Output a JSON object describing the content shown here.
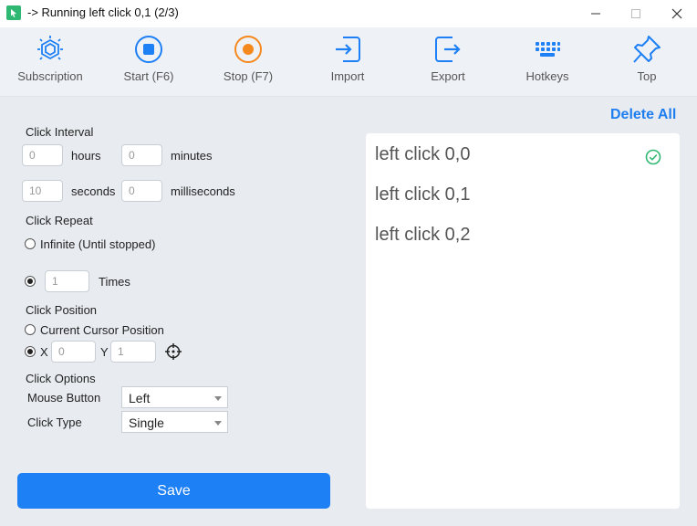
{
  "window": {
    "title": "-> Running left click 0,1 (2/3)"
  },
  "toolbar": {
    "items": [
      {
        "label": "Subscription",
        "icon": "gem-icon"
      },
      {
        "label": "Start (F6)",
        "icon": "start-icon"
      },
      {
        "label": "Stop (F7)",
        "icon": "stop-icon"
      },
      {
        "label": "Import",
        "icon": "import-icon"
      },
      {
        "label": "Export",
        "icon": "export-icon"
      },
      {
        "label": "Hotkeys",
        "icon": "keyboard-icon"
      },
      {
        "label": "Top",
        "icon": "pin-icon"
      }
    ]
  },
  "interval": {
    "title": "Click Interval",
    "hours_value": "0",
    "hours_label": "hours",
    "minutes_value": "0",
    "minutes_label": "minutes",
    "seconds_value": "10",
    "seconds_label": "seconds",
    "ms_value": "0",
    "ms_label": "milliseconds"
  },
  "repeat": {
    "title": "Click Repeat",
    "infinite_label": "Infinite (Until stopped)",
    "times_value": "1",
    "times_label": "Times",
    "selected": "times"
  },
  "position": {
    "title": "Click Position",
    "cursor_label": "Current Cursor Position",
    "x_label": "X",
    "x_value": "0",
    "y_label": "Y",
    "y_value": "1",
    "selected": "xy"
  },
  "options": {
    "title": "Click Options",
    "mouse_button_label": "Mouse Button",
    "mouse_button_value": "Left",
    "click_type_label": "Click Type",
    "click_type_value": "Single"
  },
  "save_label": "Save",
  "list": {
    "delete_all_label": "Delete All",
    "items": [
      {
        "text": "left click 0,0",
        "done": true
      },
      {
        "text": "left click 0,1",
        "done": false
      },
      {
        "text": "left click 0,2",
        "done": false
      }
    ]
  },
  "colors": {
    "accent": "#1e80f5",
    "success": "#2fb872",
    "stop": "#f5891e"
  }
}
